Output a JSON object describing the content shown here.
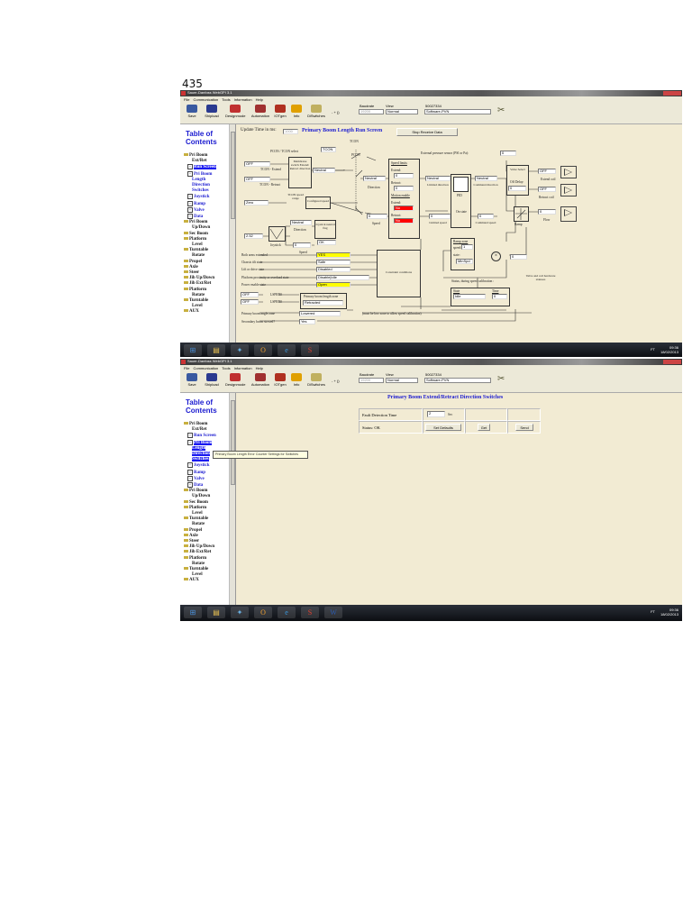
{
  "page_number": "435",
  "app": {
    "window_title": "Sauer-Danfoss WebGPI 3.1",
    "menu": [
      "File",
      "Communication",
      "Tools",
      "Information",
      "Help"
    ],
    "toolbar": [
      {
        "label": "Save",
        "icon": "save-icon",
        "color": "#3a5aa0"
      },
      {
        "label": "Shipload",
        "icon": "ship-icon",
        "color": "#2a3a90"
      },
      {
        "label": "Designmode",
        "icon": "design-icon",
        "color": "#c03030"
      },
      {
        "label": "Automation",
        "icon": "automation-icon",
        "color": "#a03030"
      },
      {
        "label": "IOTgen",
        "icon": "iotgen-icon",
        "color": "#b03020"
      },
      {
        "label": "Info",
        "icon": "info-icon",
        "color": "#e0a000"
      },
      {
        "label": "DiSwitches",
        "icon": "switches-icon",
        "color": "#c0b060"
      }
    ],
    "zoom_controls": "- + ()",
    "baudrate_label": "Baudrate",
    "baudrate_value": "19200",
    "view_label": "View",
    "view_value": "Normal",
    "device_id": "50027334",
    "software_value": "Software-PVN"
  },
  "sidebar": {
    "title": "Table of Contents",
    "items": [
      {
        "label": "Pri Boom",
        "cont": "Ext/Ret",
        "type": "folder"
      },
      {
        "label": "Run Screen",
        "type": "sub"
      },
      {
        "label": "Pri Boom",
        "cont": "Length",
        "cont2": "Direction",
        "cont3": "Switches",
        "type": "sub"
      },
      {
        "label": "Joystick",
        "type": "sub"
      },
      {
        "label": "Ramp",
        "type": "sub"
      },
      {
        "label": "Valve",
        "type": "sub"
      },
      {
        "label": "Data",
        "type": "sub"
      },
      {
        "label": "Pri Boom",
        "cont": "Up/Down",
        "type": "folder"
      },
      {
        "label": "Sec Boom",
        "type": "folder"
      },
      {
        "label": "Platform",
        "cont": "Level",
        "type": "folder"
      },
      {
        "label": "Turntable",
        "cont": "Rotate",
        "type": "folder"
      },
      {
        "label": "Propel",
        "type": "folder"
      },
      {
        "label": "Axle",
        "type": "folder"
      },
      {
        "label": "Steer",
        "type": "folder"
      },
      {
        "label": "Jib Up/Down",
        "type": "folder"
      },
      {
        "label": "Jib Ext/Ret",
        "type": "folder"
      },
      {
        "label": "Platform",
        "cont": "Rotate",
        "type": "folder"
      },
      {
        "label": "Turntable",
        "cont": "Level",
        "type": "folder"
      },
      {
        "label": "AUX",
        "type": "folder"
      }
    ]
  },
  "screen1": {
    "update_label": "Update Time in ms:",
    "update_value": "1000",
    "title": "Primary Boom Length Run Screen",
    "stop_button": "Stop Receive Data",
    "pcon_tcon_label": "PCON / TCON select",
    "pcon_tcon_value": "TCON",
    "switch_tcon": "TCON",
    "switch_pcon": "PCON",
    "tcon_extend_value": "OFF",
    "tcon_extend_label": "TCON - Extend",
    "tcon_retract_value": "OFF",
    "tcon_retract_label": "TCON - Retract",
    "membrane_box": "Membrane switch Extend/ Retract direction",
    "membrane_out": "Neutral",
    "speed_range_value": "Zero",
    "speed_range_label": "TCON speed range",
    "configured_speed": "Configured speed",
    "joystick_value": "2.52",
    "joystick_label": "Joystick",
    "joy_direction_value": "Neutral",
    "joy_direction_label": "Direction",
    "joy_flag_box": "Joystick neutral flag",
    "joy_flag_value": "OK",
    "joy_speed_value": "0",
    "joy_speed_label": "Speed",
    "direction_value": "Neutral",
    "direction_label": "Direction",
    "speed_value": "0",
    "speed_label": "Speed",
    "speed_limits": {
      "title": "Speed limits",
      "extend_label": "Extend:",
      "extend_value": "0",
      "retract_label": "Retract:",
      "retract_value": "0",
      "motion_title": "Motion enable",
      "m_extend_label": "Extend:",
      "m_extend_value": "No",
      "m_retract_label": "Retract:",
      "m_retract_value": "No"
    },
    "limited_direction_value": "Neutral",
    "limited_direction_label": "Limited direction",
    "limited_speed_value": "0",
    "limited_speed_label": "Limited speed",
    "pid_label": "PID",
    "on_state_label": "On state",
    "command_direction_value": "Neutral",
    "command_direction_label": "Command direction",
    "command_speed_value": "0",
    "command_speed_label": "Command speed",
    "ext_pressure_label": "External pressure sensor (PSI or Pa):",
    "ext_pressure_value": "0",
    "valve_select_box": "Valve Select",
    "off_delay_label": "Off Delay:",
    "off_delay_value": "0",
    "extend_coil_value": "OFF",
    "extend_coil_label": "Extend coil",
    "retract_coil_value": "OFF",
    "retract_coil_label": "Retract coil",
    "ramp_label": "Ramp",
    "flow_value": "0",
    "flow_label": "Flow",
    "conditions": [
      {
        "label": "Both arms extended",
        "value": "YES",
        "hl": "yel"
      },
      {
        "label": "Chassis tilt state",
        "value": "Safe",
        "hl": ""
      },
      {
        "label": "Lift or drive state",
        "value": "Disabled",
        "hl": ""
      },
      {
        "label": "Platform proximity or overload state",
        "value": "Disable|Idle",
        "hl": ""
      },
      {
        "label": "Power enable state",
        "value": "Open",
        "hl": "yel"
      }
    ],
    "constraint_box": "Constraint conditions",
    "lsprb0_value": "OFF",
    "lsprb0_label": "LSPRB0",
    "lsprb1_value": "OFF",
    "lsprb1_label": "LSPRB0",
    "length_zone_label": "Primary boom length zone",
    "length_zone_value": "Retracted",
    "angle_zone_label": "Primary boom angle zone",
    "angle_zone_value": "Lowered",
    "angle_note": "(must be low zone to allow speed calibration)",
    "sec_boom_label": "Secondary boom stowed?",
    "sec_boom_value": "Yes",
    "ramp_zone_title": "Ramp zone",
    "ramp_speed_label": "speed:",
    "ramp_speed_value": "1",
    "ramp_state_label": "state:",
    "ramp_state_value": "MinSpd",
    "multiplier_symbol": "×",
    "multiplier_out": "0",
    "calib_label": "Status, during speed calibration :",
    "calib_state_label": "State",
    "calib_state_value": "Idle",
    "calib_time_label": "Time",
    "calib_time_value": "0",
    "valve_status_label": "Valve and coil hardware statuses"
  },
  "screen2": {
    "title": "Primary Boom Extend/Retract Direction Switches",
    "fault_label": "Fault Detection Time",
    "fault_value": "2",
    "fault_unit": "Sec",
    "status_label": "Status: OK",
    "set_defaults_button": "Set Defaults",
    "get_button": "Get",
    "send_button": "Send",
    "tooltip": "Primary Boom Length Error Counter Settings for Switches"
  },
  "taskbar": {
    "lang": "FT",
    "time": "09:36",
    "date": "18/02/2013"
  }
}
